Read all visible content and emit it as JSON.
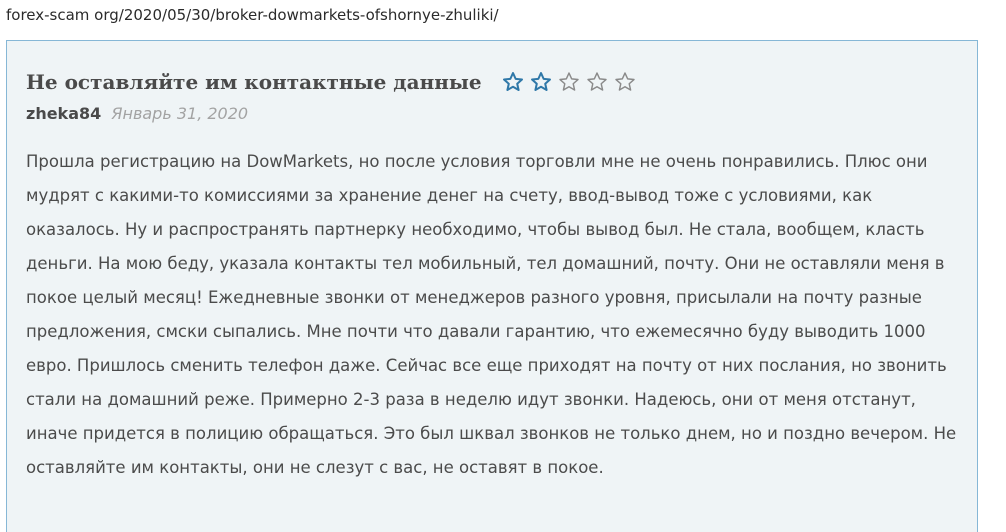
{
  "url": "forex-scam org/2020/05/30/broker-dowmarkets-ofshornye-zhuliki/",
  "review": {
    "title": "Не оставляйте им контактные данные",
    "rating": 2,
    "rating_max": 5,
    "author": "zheka84",
    "date": "Январь 31, 2020",
    "body": "Прошла регистрацию на DowMarkets, но после условия торговли мне не очень понравились. Плюс они мудрят с какими-то комиссиями за хранение денег на счету, ввод-вывод тоже с условиями, как оказалось. Ну и распространять партнерку необходимо, чтобы вывод был. Не стала, вообщем, класть деньги. На мою беду, указала контакты тел мобильный, тел домашний, почту. Они не оставляли меня в покое целый месяц! Ежедневные звонки от менеджеров разного уровня, присылали на почту разные предложения, смски сыпались. Мне почти что давали гарантию, что ежемесячно буду выводить 1000 евро. Пришлось сменить телефон даже. Сейчас все еще приходят на почту от них послания, но звонить стали на домашний реже. Примерно 2-3 раза в неделю идут звонки. Надеюсь, они от меня отстанут, иначе придется в полицию обращаться. Это был шквал звонков не только днем, но и поздно вечером. Не оставляйте им контакты, они не слезут с вас, не оставят в покое."
  },
  "colors": {
    "card_background": "#eff4f6",
    "card_border": "#86b7d6",
    "star_filled": "#2f78a8",
    "star_empty": "#8a8a8a",
    "title_text": "#4a4a4a",
    "date_text": "#a3a3a3"
  },
  "icons": {
    "star_filled": "star-filled-icon",
    "star_empty": "star-outline-icon"
  }
}
